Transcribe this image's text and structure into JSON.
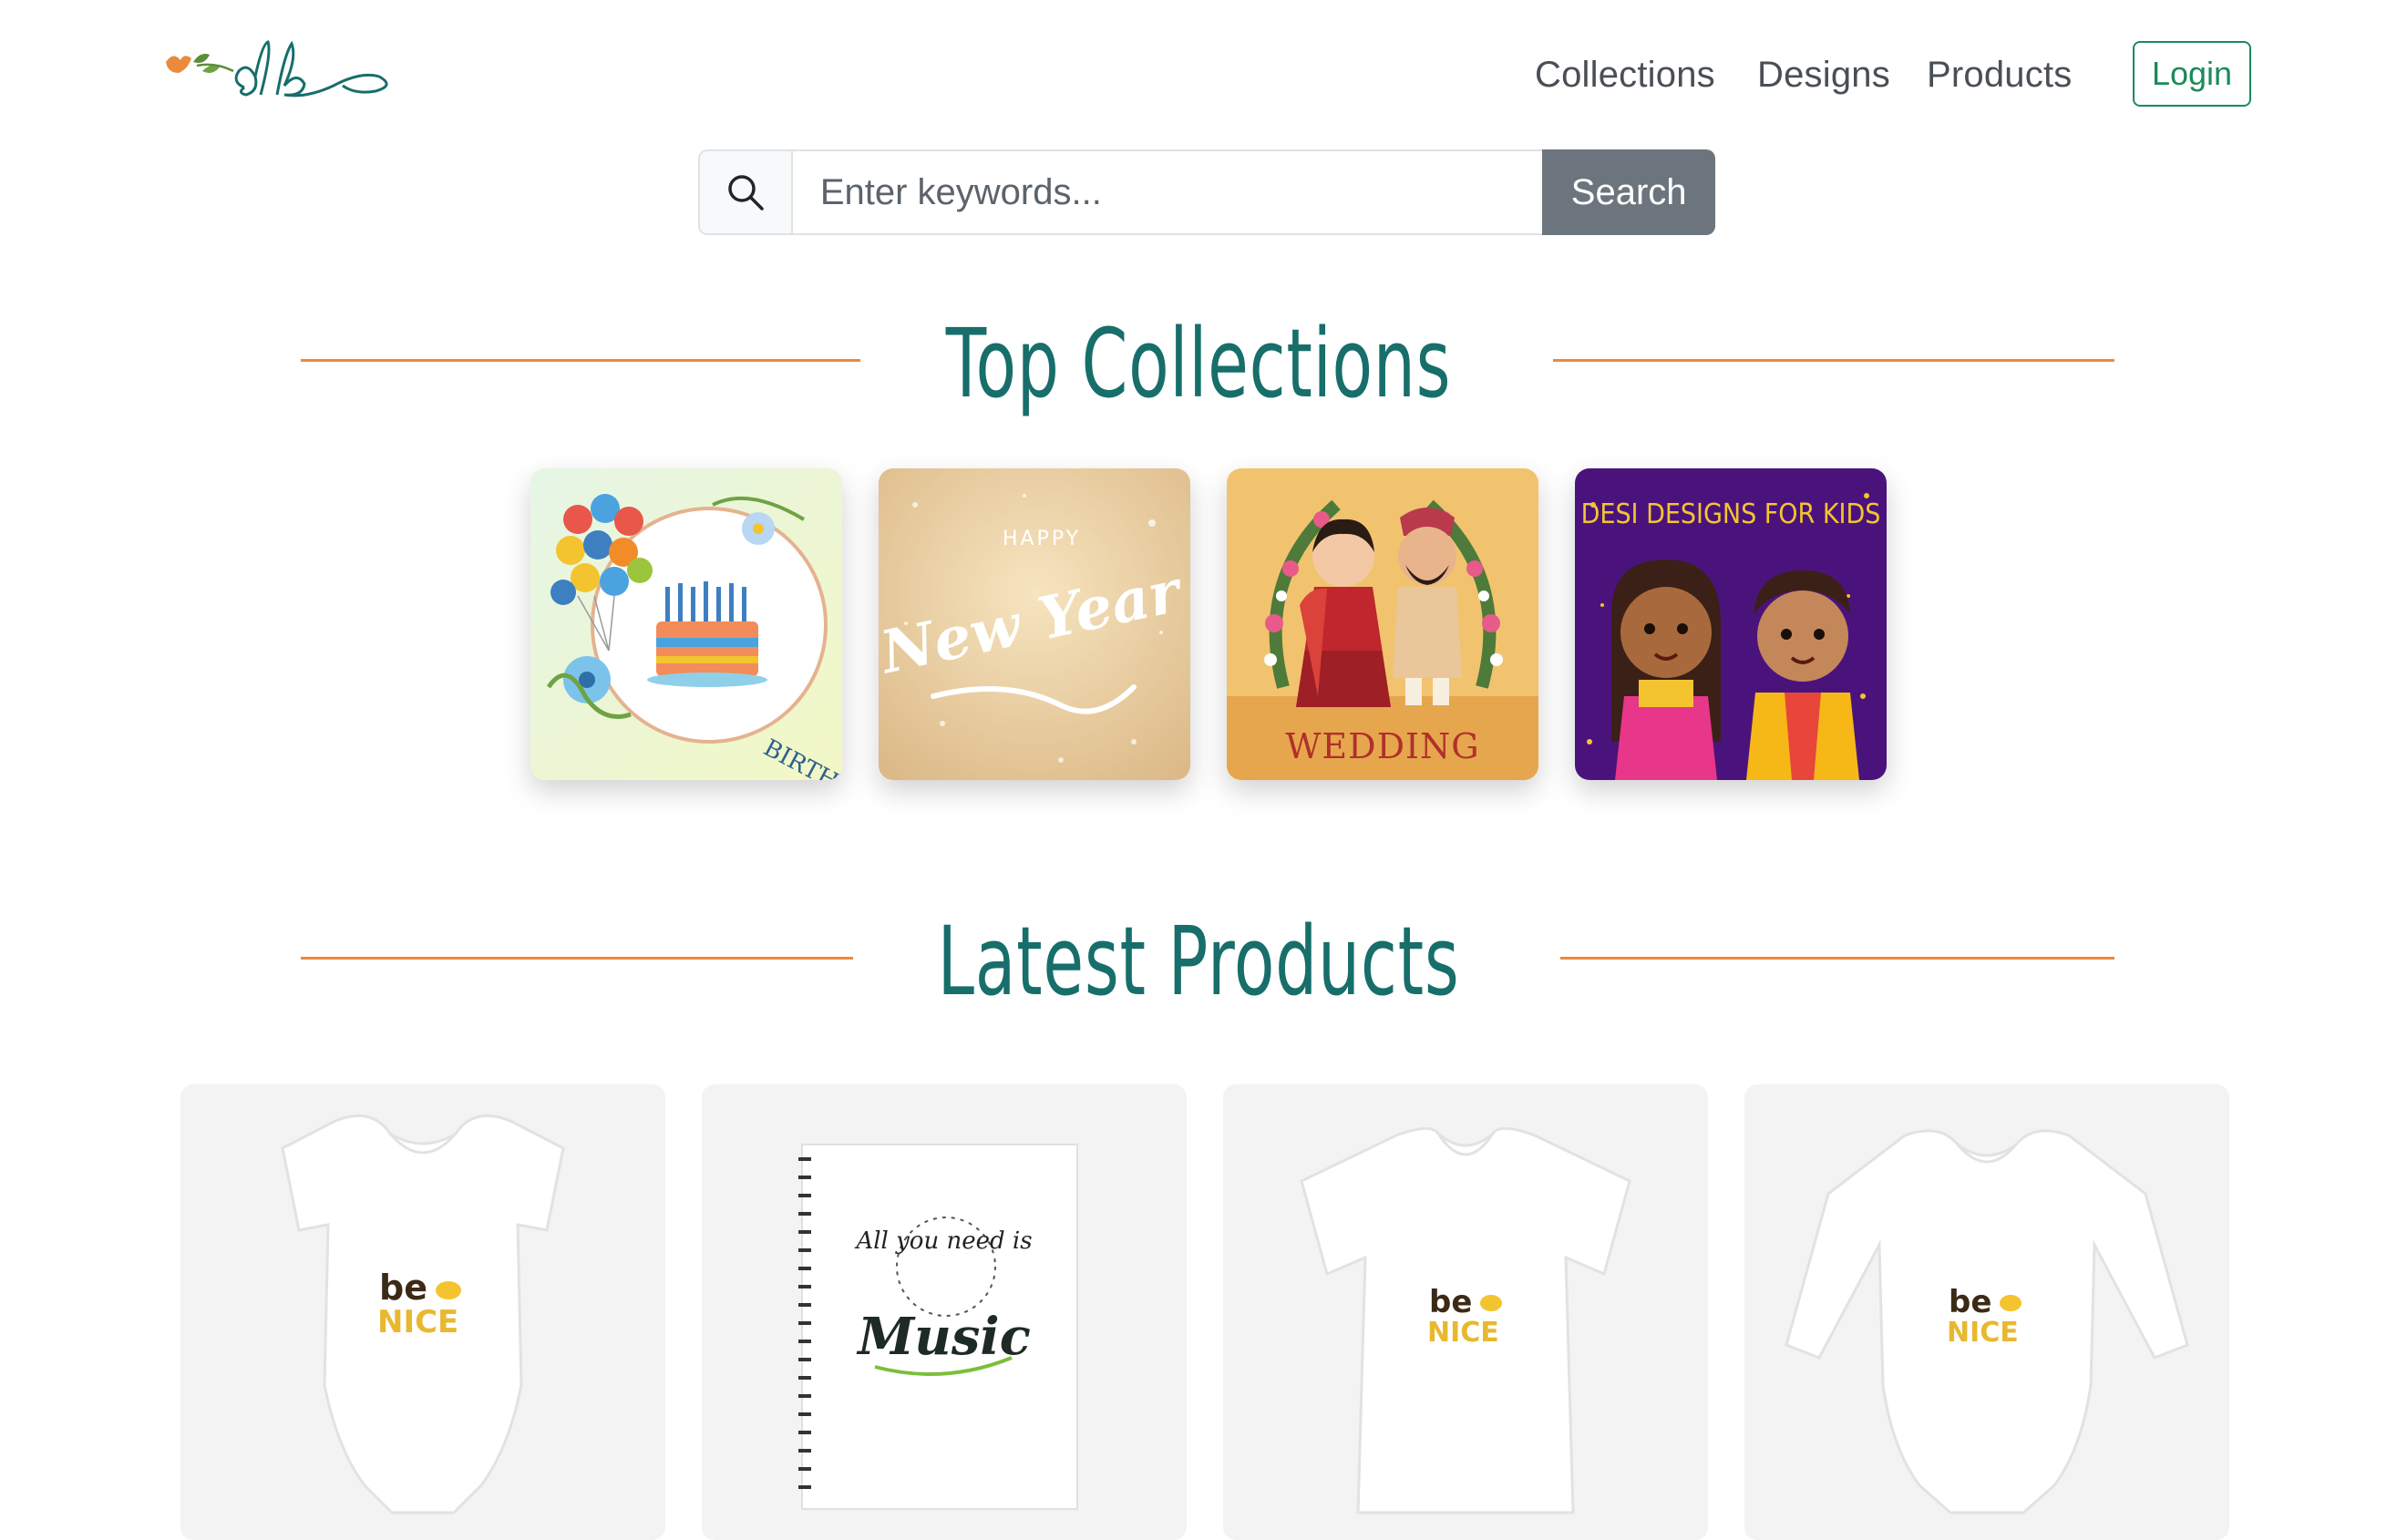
{
  "header": {
    "logo_icon": "db-script-logo",
    "nav": [
      "Collections",
      "Designs",
      "Products"
    ],
    "login_label": "Login",
    "colors": {
      "brand": "#176e6a",
      "accent": "#ea8a3c",
      "login": "#1b8a5a"
    }
  },
  "search": {
    "icon": "search-icon",
    "placeholder": "Enter keywords...",
    "button_label": "Search"
  },
  "top_collections": {
    "title": "Top Collections",
    "items": [
      {
        "name": "birthday",
        "caption": "BIRTHDAY"
      },
      {
        "name": "new-year",
        "caption_top": "HAPPY",
        "caption": "New Year"
      },
      {
        "name": "wedding",
        "caption": "WEDDING"
      },
      {
        "name": "desi-designs-for-kids",
        "caption": "DESI DESIGNS FOR KIDS"
      }
    ]
  },
  "latest_products": {
    "title": "Latest Products",
    "items": [
      {
        "name": "baby-onesie-be-nice",
        "print_line1": "be",
        "print_line2": "NICE"
      },
      {
        "name": "spiral-notebook-music",
        "print_line1": "All you need is",
        "print_line2": "Music"
      },
      {
        "name": "kids-tshirt-be-nice",
        "print_line1": "be",
        "print_line2": "NICE"
      },
      {
        "name": "long-sleeve-onesie-be-nice",
        "print_line1": "be",
        "print_line2": "NICE"
      }
    ]
  }
}
